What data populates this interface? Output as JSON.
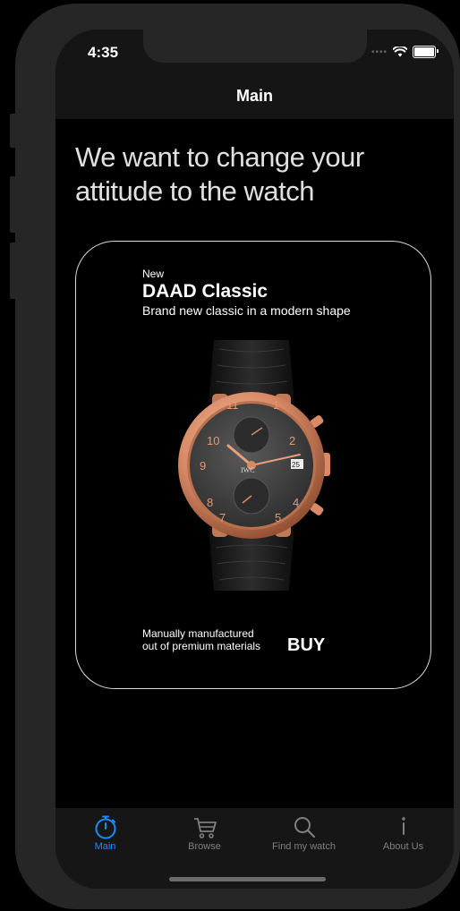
{
  "status": {
    "time": "4:35"
  },
  "nav": {
    "title": "Main"
  },
  "headline": "We want to change your attitude to the watch",
  "card": {
    "kicker": "New",
    "title": "DAAD Classic",
    "subtitle": "Brand new classic in a modern shape",
    "description": "Manually manufactured out of premium materials",
    "buy_label": "BUY"
  },
  "tabs": [
    {
      "label": "Main",
      "icon": "stopwatch-icon",
      "active": true
    },
    {
      "label": "Browse",
      "icon": "cart-icon",
      "active": false
    },
    {
      "label": "Find my watch",
      "icon": "search-icon",
      "active": false
    },
    {
      "label": "About Us",
      "icon": "info-icon",
      "active": false
    }
  ],
  "colors": {
    "accent": "#1a8cff",
    "tab_inactive": "#808080",
    "rose_gold": "#d88a66"
  }
}
